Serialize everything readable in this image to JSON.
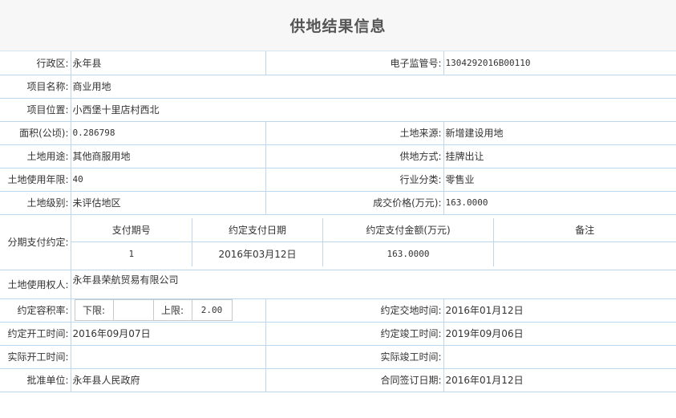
{
  "header": {
    "title": "供地结果信息"
  },
  "fields": {
    "district_label": "行政区:",
    "district": "永年县",
    "supervision_label": "电子监管号:",
    "supervision_no": "1304292016B00110",
    "project_name_label": "项目名称:",
    "project_name": "商业用地",
    "project_location_label": "项目位置:",
    "project_location": "小西堡十里店村西北",
    "area_label": "面积(公顷):",
    "area": "0.286798",
    "land_source_label": "土地来源:",
    "land_source": "新增建设用地",
    "land_use_label": "土地用途:",
    "land_use": "其他商服用地",
    "supply_method_label": "供地方式:",
    "supply_method": "挂牌出让",
    "use_years_label": "土地使用年限:",
    "use_years": "40",
    "industry_label": "行业分类:",
    "industry": "零售业",
    "land_level_label": "土地级别:",
    "land_level": "未评估地区",
    "price_label": "成交价格(万元):",
    "price": "163.0000",
    "installment_label": "分期支付约定:",
    "holder_label": "土地使用权人:",
    "holder": "永年县荣航贸易有限公司",
    "far_label": "约定容积率:",
    "far_lower_label": "下限:",
    "far_lower": "",
    "far_upper_label": "上限:",
    "far_upper": "2.00",
    "handover_label": "约定交地时间:",
    "handover_date": "2016年01月12日",
    "start_label": "约定开工时间:",
    "start_date": "2016年09月07日",
    "complete_label": "约定竣工时间:",
    "complete_date": "2019年09月06日",
    "actual_start_label": "实际开工时间:",
    "actual_start": "",
    "actual_complete_label": "实际竣工时间:",
    "actual_complete": "",
    "approver_label": "批准单位:",
    "approver": "永年县人民政府",
    "contract_label": "合同签订日期:",
    "contract_date": "2016年01月12日"
  },
  "installments": {
    "headers": [
      "支付期号",
      "约定支付日期",
      "约定支付金额(万元)",
      "备注"
    ],
    "rows": [
      [
        "1",
        "2016年03月12日",
        "163.0000",
        ""
      ]
    ]
  }
}
